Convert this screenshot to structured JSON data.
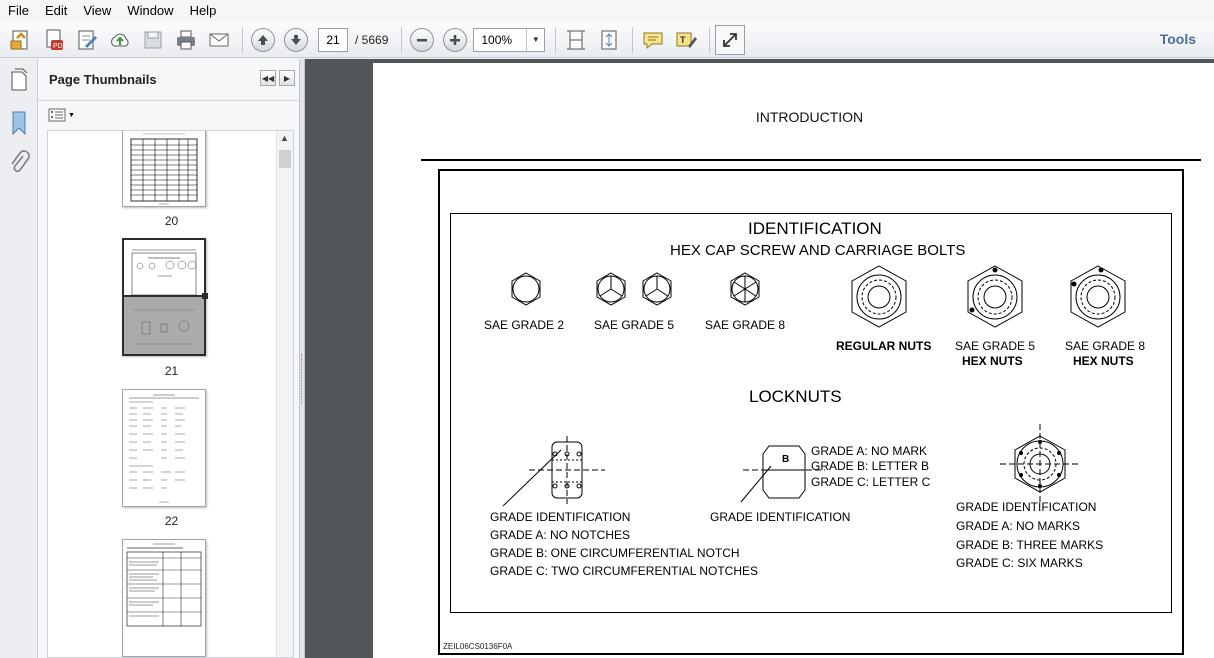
{
  "menu": [
    "File",
    "Edit",
    "View",
    "Window",
    "Help"
  ],
  "toolbar": {
    "current_page": "21",
    "total_pages": "/ 5669",
    "zoom": "100%",
    "tools_label": "Tools"
  },
  "thumbnails": {
    "title": "Page Thumbnails",
    "pages": [
      {
        "label": "20"
      },
      {
        "label": "21"
      },
      {
        "label": "22"
      },
      {
        "label": ""
      }
    ]
  },
  "page": {
    "header": "INTRODUCTION",
    "figure": {
      "title": "IDENTIFICATION",
      "subtitle": "HEX CAP SCREW AND CARRIAGE BOLTS",
      "bolt_labels": [
        "SAE GRADE 2",
        "SAE GRADE 5",
        "SAE GRADE 8"
      ],
      "nut_labels": {
        "regular": "REGULAR NUTS",
        "grade5_line1": "SAE GRADE 5",
        "grade5_line2": "HEX NUTS",
        "grade8_line1": "SAE GRADE 8",
        "grade8_line2": "HEX NUTS"
      },
      "locknuts_title": "LOCKNUTS",
      "locknut_left": {
        "title": "GRADE IDENTIFICATION",
        "lines": [
          "GRADE A: NO NOTCHES",
          "GRADE B: ONE CIRCUMFERENTIAL NOTCH",
          "GRADE C: TWO CIRCUMFERENTIAL NOTCHES"
        ]
      },
      "locknut_middle": {
        "title": "GRADE IDENTIFICATION",
        "letter": "B",
        "lines": [
          "GRADE A: NO MARK",
          "GRADE B: LETTER B",
          "GRADE C: LETTER C"
        ]
      },
      "locknut_right": {
        "title": "GRADE IDENTIFICATION",
        "lines": [
          "GRADE A: NO MARKS",
          "GRADE B: THREE MARKS",
          "GRADE C: SIX MARKS"
        ]
      },
      "code": "ZEIL06CS0136F0A"
    }
  },
  "colors": {
    "doc_background": "#525659",
    "tools_link": "#4a6f9a"
  }
}
